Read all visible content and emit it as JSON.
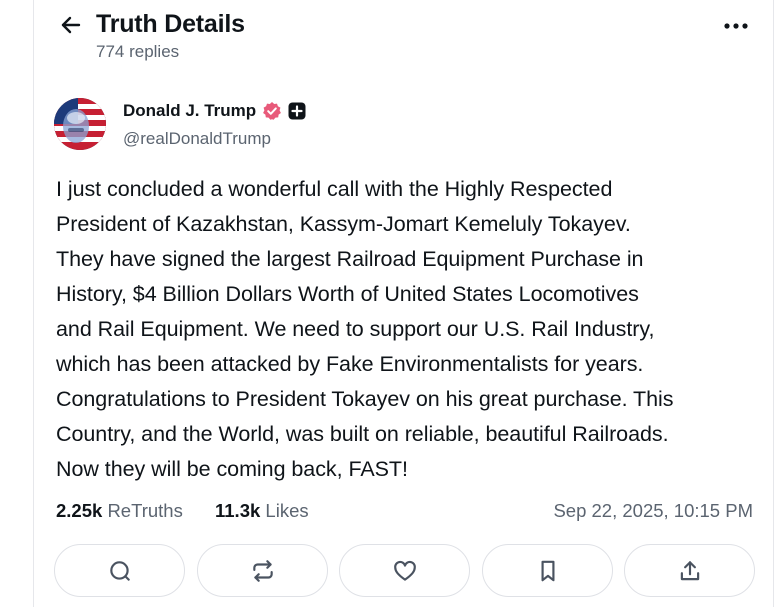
{
  "header": {
    "title": "Truth Details",
    "replies": "774 replies"
  },
  "author": {
    "name": "Donald J. Trump",
    "handle": "@realDonaldTrump"
  },
  "post": {
    "text": "I just concluded a wonderful call with the Highly Respected\nPresident of Kazakhstan, Kassym-Jomart Kemeluly Tokayev.\nThey have signed the largest Railroad Equipment Purchase in\nHistory, $4 Billion Dollars Worth of United States Locomotives\nand Rail Equipment. We need to support our U.S. Rail Industry,\nwhich has been attacked by Fake Environmentalists for years.\nCongratulations to President Tokayev on his great purchase. This\nCountry, and the World, was built on reliable, beautiful Railroads.\nNow they will be coming back, FAST!"
  },
  "stats": {
    "retruths_count": "2.25k",
    "retruths_label": "ReTruths",
    "likes_count": "11.3k",
    "likes_label": "Likes",
    "timestamp": "Sep 22, 2025, 10:15 PM"
  },
  "actions": [
    {
      "icon": "reply-icon"
    },
    {
      "icon": "retruth-icon"
    },
    {
      "icon": "heart-icon"
    },
    {
      "icon": "bookmark-icon"
    },
    {
      "icon": "share-icon"
    }
  ],
  "colors": {
    "verified": "#e85a7a",
    "muted": "#5b6470",
    "border": "#dfe1e6"
  }
}
